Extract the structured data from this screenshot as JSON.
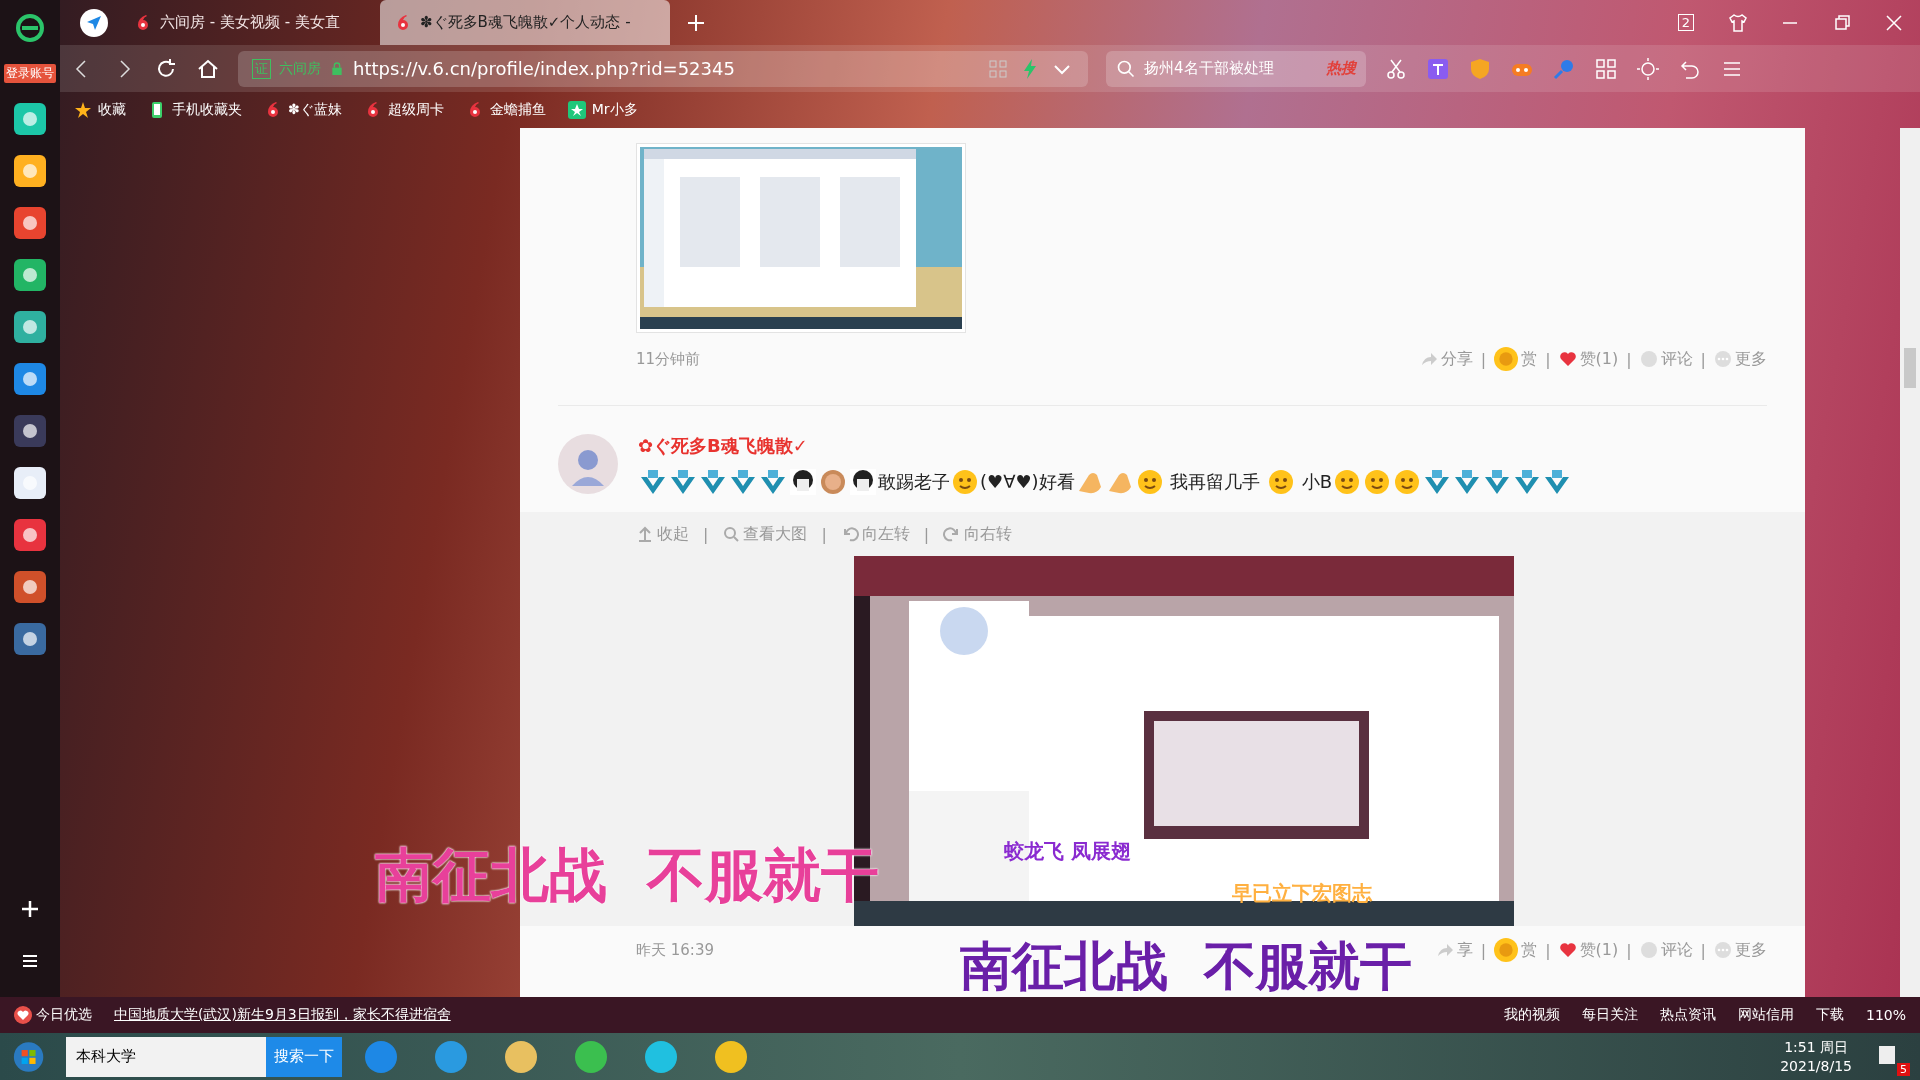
{
  "sidebar": {
    "login": "登录账号"
  },
  "tabs": [
    {
      "label": "六间房 - 美女视频 - 美女直",
      "selected": false
    },
    {
      "label": "✽ぐ死多B魂飞魄散✓个人动态 -",
      "selected": true
    }
  ],
  "window": {
    "tab_count": "2"
  },
  "address": {
    "cert": "证",
    "site": "六间房",
    "url": "https://v.6.cn/profile/index.php?rid=52345"
  },
  "search": {
    "value": "扬州4名干部被处理",
    "hot": "热搜"
  },
  "bookmarks": [
    {
      "label": "收藏",
      "kind": "star"
    },
    {
      "label": "手机收藏夹",
      "kind": "phone"
    },
    {
      "label": "✽ぐ蓝妹",
      "kind": "six"
    },
    {
      "label": "超级周卡",
      "kind": "six"
    },
    {
      "label": "金蟾捕鱼",
      "kind": "six"
    },
    {
      "label": "Mr小多",
      "kind": "app"
    }
  ],
  "post1": {
    "time": "11分钟前",
    "separator": "|",
    "actions": [
      {
        "label": "分享",
        "kind": "share"
      },
      {
        "label": "赏",
        "kind": "reward"
      },
      {
        "label": "赞(1)",
        "kind": "like"
      },
      {
        "label": "评论",
        "kind": "comment"
      },
      {
        "label": "更多",
        "kind": "more"
      }
    ]
  },
  "post2": {
    "author": "✿ぐ死多B魂飞魄散✓",
    "separator": "|",
    "content": [
      {
        "kind": "five"
      },
      {
        "kind": "five"
      },
      {
        "kind": "five"
      },
      {
        "kind": "five"
      },
      {
        "kind": "five"
      },
      {
        "kind": "face"
      },
      {
        "kind": "coin"
      },
      {
        "kind": "face"
      },
      {
        "kind": "text",
        "text": "敢踢老子"
      },
      {
        "kind": "smile"
      },
      {
        "kind": "text",
        "text": "(♥∀♥)好看"
      },
      {
        "kind": "hand"
      },
      {
        "kind": "hand"
      },
      {
        "kind": "smile"
      },
      {
        "kind": "text",
        "text": " 我再留几手 "
      },
      {
        "kind": "smile"
      },
      {
        "kind": "text",
        "text": " 小B"
      },
      {
        "kind": "smile"
      },
      {
        "kind": "smile"
      },
      {
        "kind": "smile"
      },
      {
        "kind": "five"
      },
      {
        "kind": "five"
      },
      {
        "kind": "five"
      },
      {
        "kind": "five"
      },
      {
        "kind": "five"
      }
    ],
    "tools": [
      {
        "label": "收起",
        "kind": "up"
      },
      {
        "label": "查看大图",
        "kind": "zoom"
      },
      {
        "label": "向左转",
        "kind": "left"
      },
      {
        "label": "向右转",
        "kind": "right"
      }
    ],
    "image_texts": [
      "蛟龙飞  凤展翅",
      "早已立下宏图志"
    ],
    "time": "昨天 16:39",
    "actions": [
      {
        "label": "享",
        "kind": "share"
      },
      {
        "label": "赏",
        "kind": "reward"
      },
      {
        "label": "赞(1)",
        "kind": "like"
      },
      {
        "label": "评论",
        "kind": "comment"
      },
      {
        "label": "更多",
        "kind": "more"
      }
    ]
  },
  "overlays": [
    "南征北战  不服就干",
    "南征北战  不服就干"
  ],
  "status_bar": {
    "today": "今日优选",
    "news": "中国地质大学(武汉)新生9月3日报到，家长不得进宿舍",
    "items": [
      "我的视频",
      "每日关注",
      "热点资讯",
      "网站信用"
    ],
    "download": "下载",
    "zoom": "110%"
  },
  "taskbar": {
    "search": "本科大学",
    "search_button": "搜索一下",
    "time": "1:51 周日",
    "date": "2021/8/15",
    "notifications": "5"
  }
}
